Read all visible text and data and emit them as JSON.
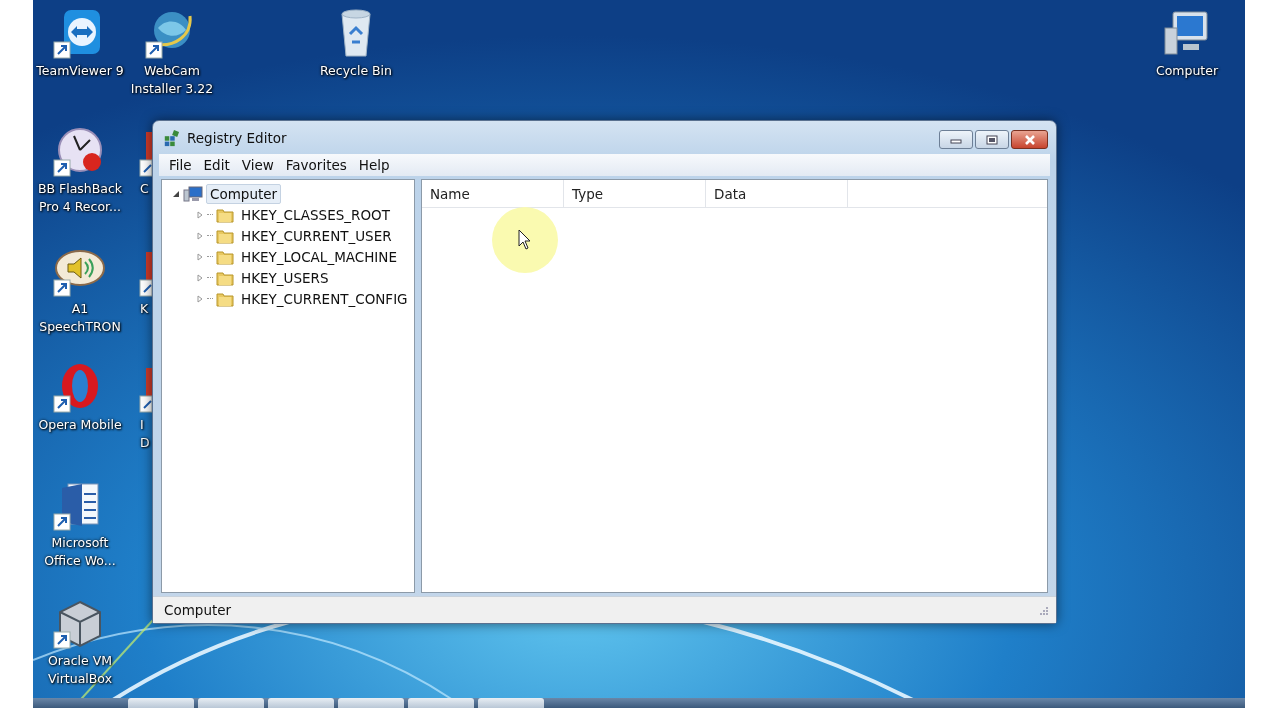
{
  "desktop": {
    "icons": [
      {
        "label": "TeamViewer 9",
        "kind": "teamviewer"
      },
      {
        "label": "WebCam Installer 3.22",
        "kind": "globe"
      },
      {
        "label": "Recycle Bin",
        "kind": "recycle"
      },
      {
        "label": "Computer",
        "kind": "computer"
      },
      {
        "label": "BB FlashBack Pro 4 Recor...",
        "kind": "clock"
      },
      {
        "label": "A1 SpeechTRON",
        "kind": "speaker"
      },
      {
        "label": "Opera Mobile",
        "kind": "opera"
      },
      {
        "label": "Microsoft Office Wo...",
        "kind": "word"
      },
      {
        "label": "Oracle VM VirtualBox",
        "kind": "cube"
      },
      {
        "label": "C",
        "kind": "partial"
      },
      {
        "label": "K",
        "kind": "partial"
      },
      {
        "label": "I D",
        "kind": "partial"
      }
    ]
  },
  "window": {
    "title": "Registry Editor",
    "menu": [
      "File",
      "Edit",
      "View",
      "Favorites",
      "Help"
    ],
    "tree": {
      "label": "Computer",
      "expanded": true,
      "selected": true,
      "children": [
        {
          "label": "HKEY_CLASSES_ROOT",
          "expanded": false,
          "selected": false
        },
        {
          "label": "HKEY_CURRENT_USER",
          "expanded": false,
          "selected": false
        },
        {
          "label": "HKEY_LOCAL_MACHINE",
          "expanded": false,
          "selected": false
        },
        {
          "label": "HKEY_USERS",
          "expanded": false,
          "selected": false
        },
        {
          "label": "HKEY_CURRENT_CONFIG",
          "expanded": false,
          "selected": false
        }
      ]
    },
    "columns": [
      "Name",
      "Type",
      "Data"
    ],
    "status_bar": "Computer"
  }
}
